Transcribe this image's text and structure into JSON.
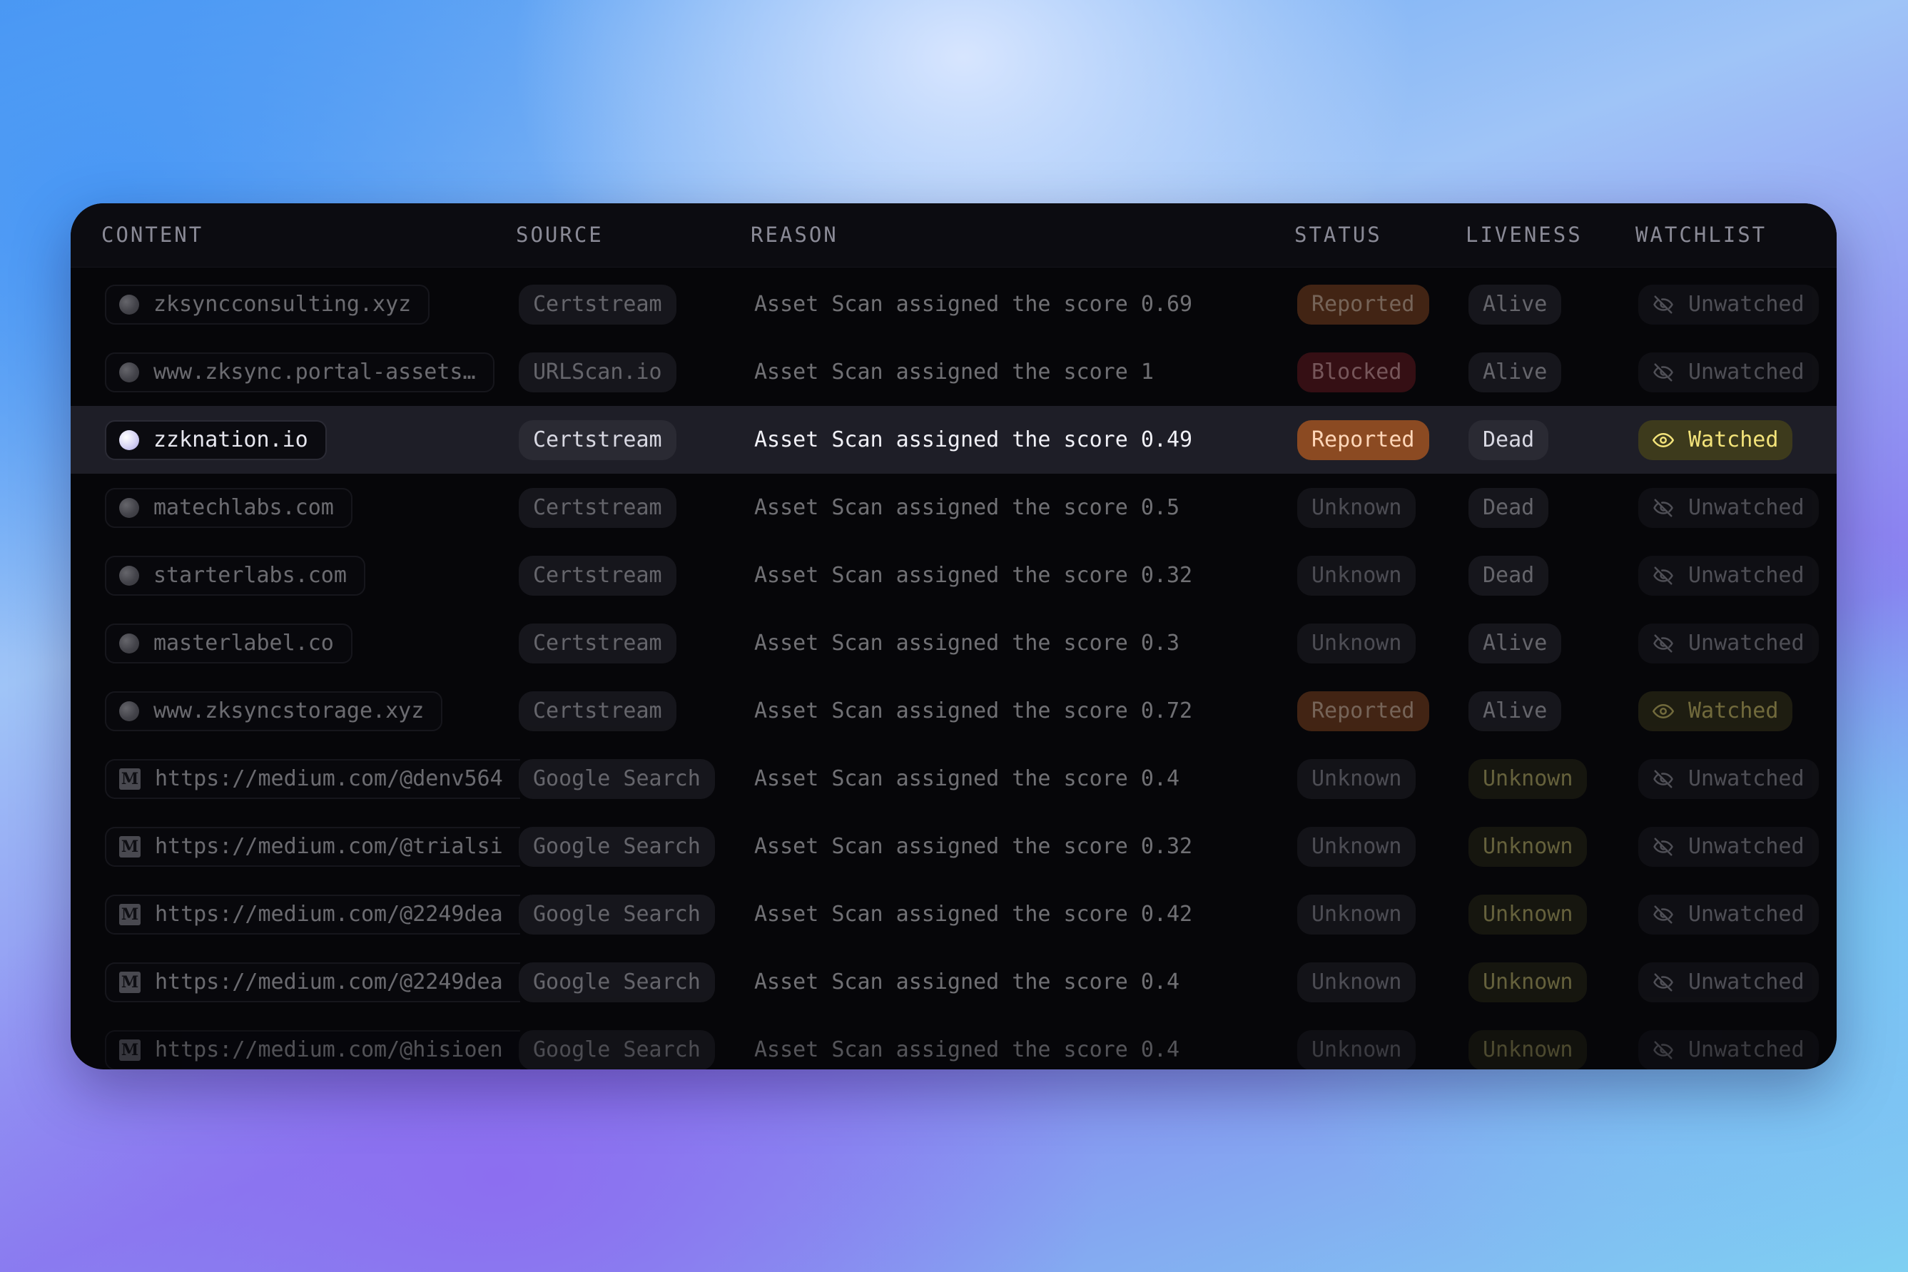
{
  "columns": {
    "content": "CONTENT",
    "source": "SOURCE",
    "reason": "REASON",
    "status": "STATUS",
    "liveness": "LIVENESS",
    "watchlist": "WATCHLIST"
  },
  "colors": {
    "reported": "#8b4a22",
    "blocked": "#6e1c22",
    "watched": "#f3e37a",
    "highlight_row": "#1e1e27",
    "panel_bg": "#060609"
  },
  "rows": [
    {
      "content": "zksyncconsulting.xyz",
      "icon": "globe-icon",
      "source": "Certstream",
      "reason": "Asset Scan assigned the score 0.69",
      "status": "Reported",
      "liveness": "Alive",
      "watchlist": "Unwatched"
    },
    {
      "content": "www.zksync.portal-assets…",
      "icon": "globe-icon",
      "source": "URLScan.io",
      "reason": "Asset Scan assigned the score 1",
      "status": "Blocked",
      "liveness": "Alive",
      "watchlist": "Unwatched"
    },
    {
      "content": "zzknation.io",
      "icon": "globe-icon",
      "source": "Certstream",
      "reason": "Asset Scan assigned the score 0.49",
      "status": "Reported",
      "liveness": "Dead",
      "watchlist": "Watched"
    },
    {
      "content": "matechlabs.com",
      "icon": "globe-icon",
      "source": "Certstream",
      "reason": "Asset Scan assigned the score 0.5",
      "status": "Unknown",
      "liveness": "Dead",
      "watchlist": "Unwatched"
    },
    {
      "content": "starterlabs.com",
      "icon": "globe-icon",
      "source": "Certstream",
      "reason": "Asset Scan assigned the score 0.32",
      "status": "Unknown",
      "liveness": "Dead",
      "watchlist": "Unwatched"
    },
    {
      "content": "masterlabel.co",
      "icon": "globe-icon",
      "source": "Certstream",
      "reason": "Asset Scan assigned the score 0.3",
      "status": "Unknown",
      "liveness": "Alive",
      "watchlist": "Unwatched"
    },
    {
      "content": "www.zksyncstorage.xyz",
      "icon": "globe-icon",
      "source": "Certstream",
      "reason": "Asset Scan assigned the score 0.72",
      "status": "Reported",
      "liveness": "Alive",
      "watchlist": "Watched"
    },
    {
      "content": "https://medium.com/@denv564",
      "icon": "medium-icon",
      "source": "Google Search",
      "reason": "Asset Scan assigned the score 0.4",
      "status": "Unknown",
      "liveness": "Unknown",
      "watchlist": "Unwatched"
    },
    {
      "content": "https://medium.com/@trialsi",
      "icon": "medium-icon",
      "source": "Google Search",
      "reason": "Asset Scan assigned the score 0.32",
      "status": "Unknown",
      "liveness": "Unknown",
      "watchlist": "Unwatched"
    },
    {
      "content": "https://medium.com/@2249dea",
      "icon": "medium-icon",
      "source": "Google Search",
      "reason": "Asset Scan assigned the score 0.42",
      "status": "Unknown",
      "liveness": "Unknown",
      "watchlist": "Unwatched"
    },
    {
      "content": "https://medium.com/@2249dea",
      "icon": "medium-icon",
      "source": "Google Search",
      "reason": "Asset Scan assigned the score 0.4",
      "status": "Unknown",
      "liveness": "Unknown",
      "watchlist": "Unwatched"
    },
    {
      "content": "https://medium.com/@hisioen",
      "icon": "medium-icon",
      "source": "Google Search",
      "reason": "Asset Scan assigned the score 0.4",
      "status": "Unknown",
      "liveness": "Unknown",
      "watchlist": "Unwatched"
    }
  ]
}
